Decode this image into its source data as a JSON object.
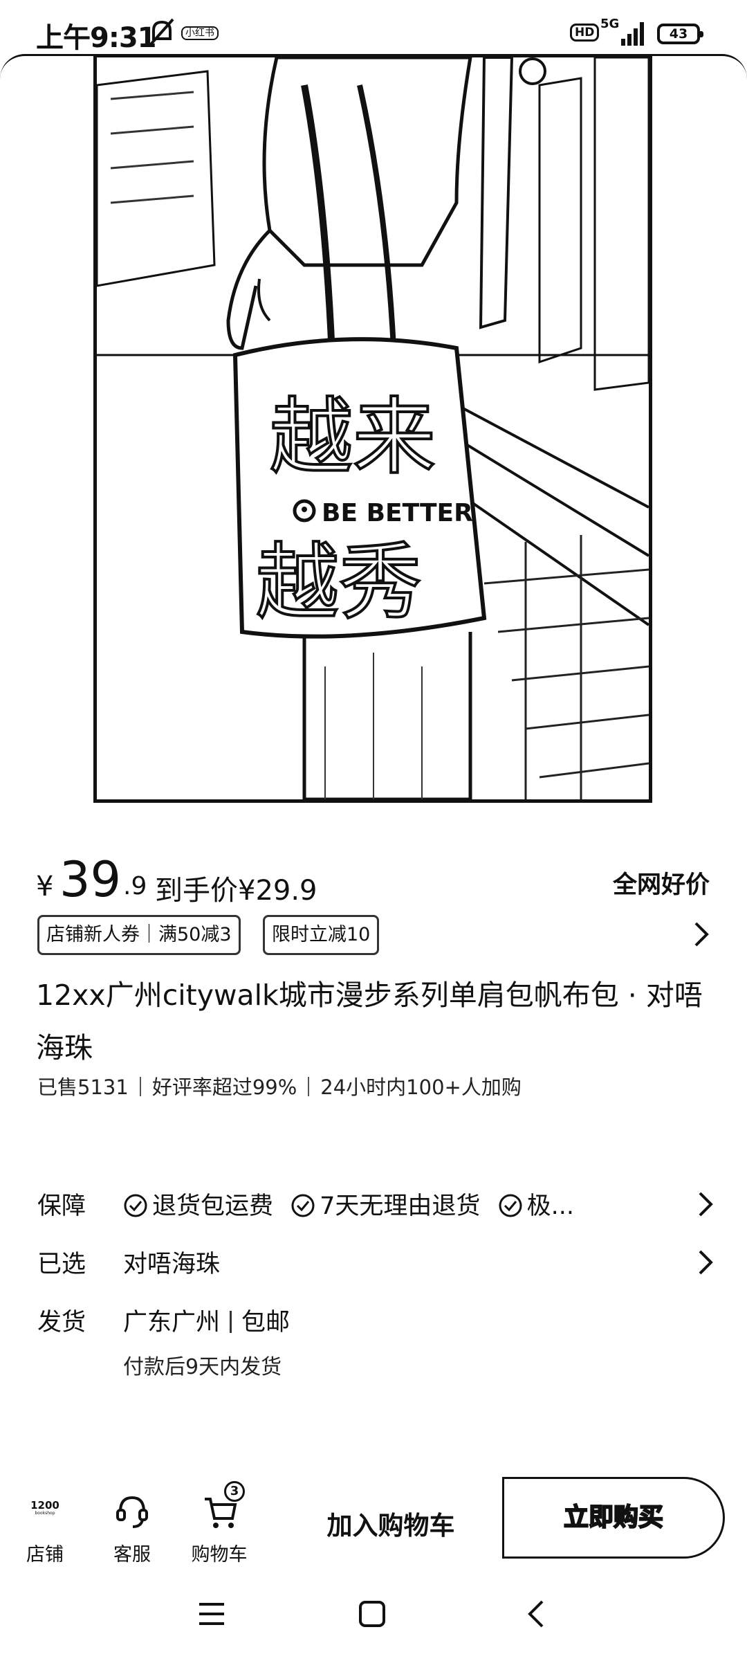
{
  "status_bar": {
    "time": "上午9:31",
    "note_icon_text": "小红书",
    "hd": "HD",
    "network": "5G",
    "battery": "43"
  },
  "product": {
    "price_symbol": "¥",
    "price_integer": "39",
    "price_decimal": ".9",
    "final_price": "到手价¥29.9",
    "best_price_tag": "全网好价",
    "coupons": [
      "店铺新人券｜满50减3",
      "限时立减10"
    ],
    "title": "12xx广州citywalk城市漫步系列单肩包帆布包 · 对唔海珠",
    "stats": {
      "sold": "已售5131",
      "rating": "好评率超过99%",
      "cart_adds": "24小时内100+人加购"
    },
    "bag_print": {
      "line1": "越来",
      "line2": "BE BETTER",
      "line3": "越秀"
    }
  },
  "info": {
    "guarantee_label": "保障",
    "guarantee_items": [
      "退货包运费",
      "7天无理由退货",
      "极..."
    ],
    "selected_label": "已选",
    "selected_value": "对唔海珠",
    "shipping_label": "发货",
    "shipping_origin": "广东广州",
    "shipping_fee": "包邮",
    "shipping_note": "付款后9天内发货"
  },
  "bottom_bar": {
    "shop_logo_text": "1200",
    "shop_logo_subtext": "bookshop",
    "shop_label": "店铺",
    "service_label": "客服",
    "cart_label": "购物车",
    "cart_badge": "3",
    "add_to_cart": "加入购物车",
    "buy_now": "立即购买"
  }
}
